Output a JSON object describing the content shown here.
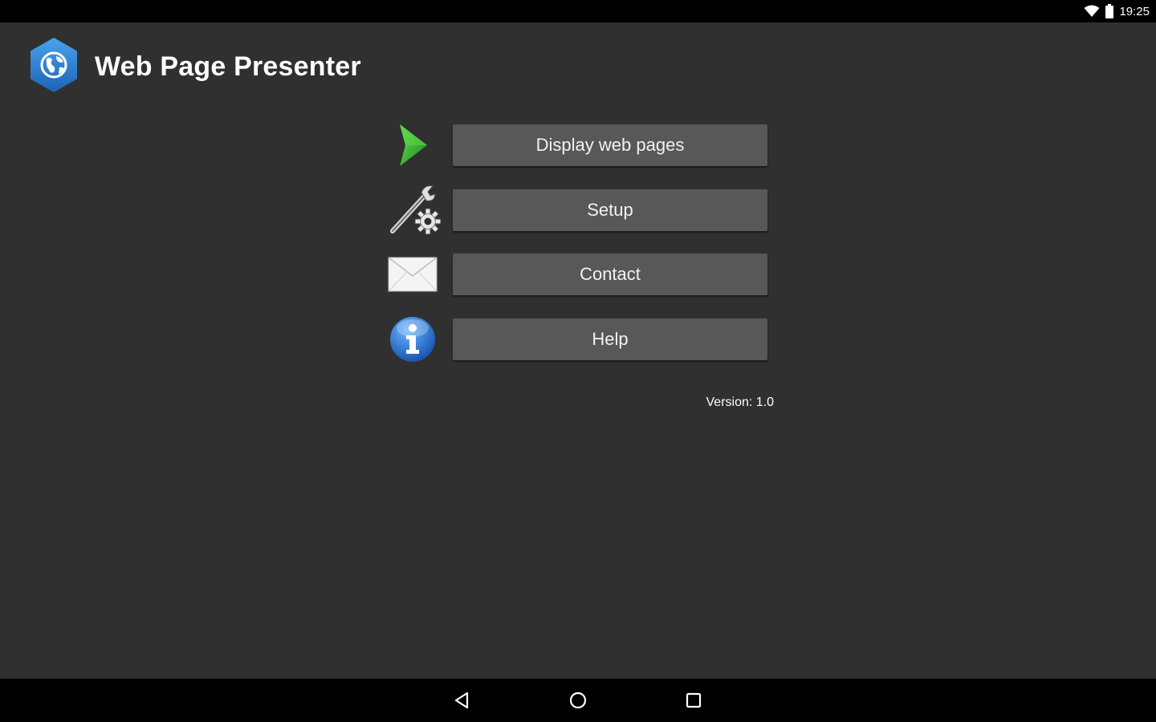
{
  "status_bar": {
    "time": "19:25",
    "icons": [
      "wifi-icon",
      "battery-icon"
    ]
  },
  "app": {
    "title": "Web Page Presenter",
    "logo_icon": "globe-hexagon-icon",
    "accent_color": "#2a7fd4"
  },
  "menu": {
    "items": [
      {
        "label": "Display web pages",
        "icon": "play-icon"
      },
      {
        "label": "Setup",
        "icon": "wrench-gear-icon"
      },
      {
        "label": "Contact",
        "icon": "envelope-icon"
      },
      {
        "label": "Help",
        "icon": "info-icon"
      }
    ]
  },
  "version_text": "Version: 1.0",
  "nav_bar": {
    "buttons": [
      "back-icon",
      "home-icon",
      "recents-icon"
    ]
  }
}
